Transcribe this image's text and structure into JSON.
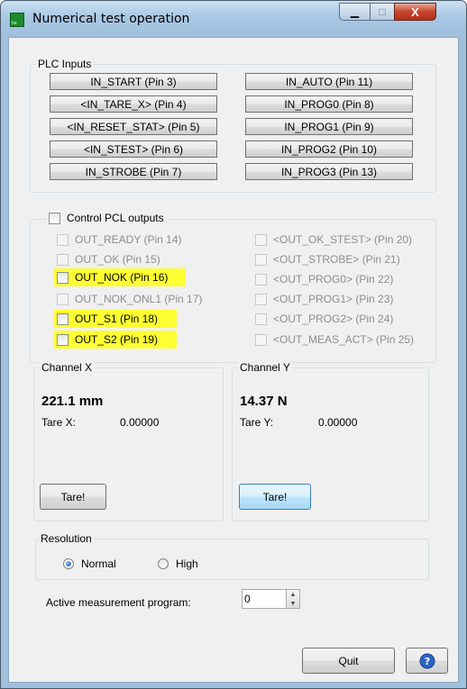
{
  "window": {
    "title": "Numerical test operation",
    "app_icon_text": "ba",
    "caption_buttons": {
      "minimize": "▁",
      "maximize": "□",
      "close": "X"
    }
  },
  "plc_inputs": {
    "title": "PLC Inputs",
    "left": [
      "IN_START (Pin 3)",
      "<IN_TARE_X> (Pin 4)",
      "<IN_RESET_STAT> (Pin 5)",
      "<IN_STEST> (Pin 6)",
      "IN_STROBE (Pin 7)"
    ],
    "right": [
      "IN_AUTO (Pin 11)",
      "IN_PROG0 (Pin 8)",
      "IN_PROG1 (Pin 9)",
      "IN_PROG2 (Pin 10)",
      "IN_PROG3 (Pin 13)"
    ]
  },
  "pcl_outputs": {
    "title": "Control PCL outputs",
    "left": [
      {
        "label": "OUT_READY (Pin 14)",
        "highlighted": false
      },
      {
        "label": "OUT_OK (Pin 15)",
        "highlighted": false
      },
      {
        "label": "OUT_NOK (Pin 16)",
        "highlighted": true
      },
      {
        "label": "OUT_NOK_ONL1 (Pin 17)",
        "highlighted": false
      },
      {
        "label": "OUT_S1 (Pin 18)",
        "highlighted": true
      },
      {
        "label": "OUT_S2 (Pin 19)",
        "highlighted": true
      }
    ],
    "right": [
      {
        "label": "<OUT_OK_STEST> (Pin 20)"
      },
      {
        "label": "<OUT_STROBE> (Pin 21)"
      },
      {
        "label": "<OUT_PROG0> (Pin 22)"
      },
      {
        "label": "<OUT_PROG1> (Pin 23)"
      },
      {
        "label": "<OUT_PROG2> (Pin 24)"
      },
      {
        "label": "<OUT_MEAS_ACT> (Pin 25)"
      }
    ]
  },
  "channel_x": {
    "title": "Channel X",
    "value": "221.1 mm",
    "tare_label": "Tare X:",
    "tare_value": "0.00000",
    "button": "Tare!"
  },
  "channel_y": {
    "title": "Channel Y",
    "value": "14.37 N",
    "tare_label": "Tare Y:",
    "tare_value": "0.00000",
    "button": "Tare!"
  },
  "resolution": {
    "title": "Resolution",
    "options": [
      "Normal",
      "High"
    ],
    "selected": "Normal"
  },
  "program": {
    "label": "Active measurement program:",
    "value": "0"
  },
  "footer": {
    "quit": "Quit",
    "help_icon": "help-icon"
  },
  "colors": {
    "highlight": "#ffff33",
    "disabled_text": "#8d8d8d",
    "title_bar": "#a9c8e4"
  }
}
